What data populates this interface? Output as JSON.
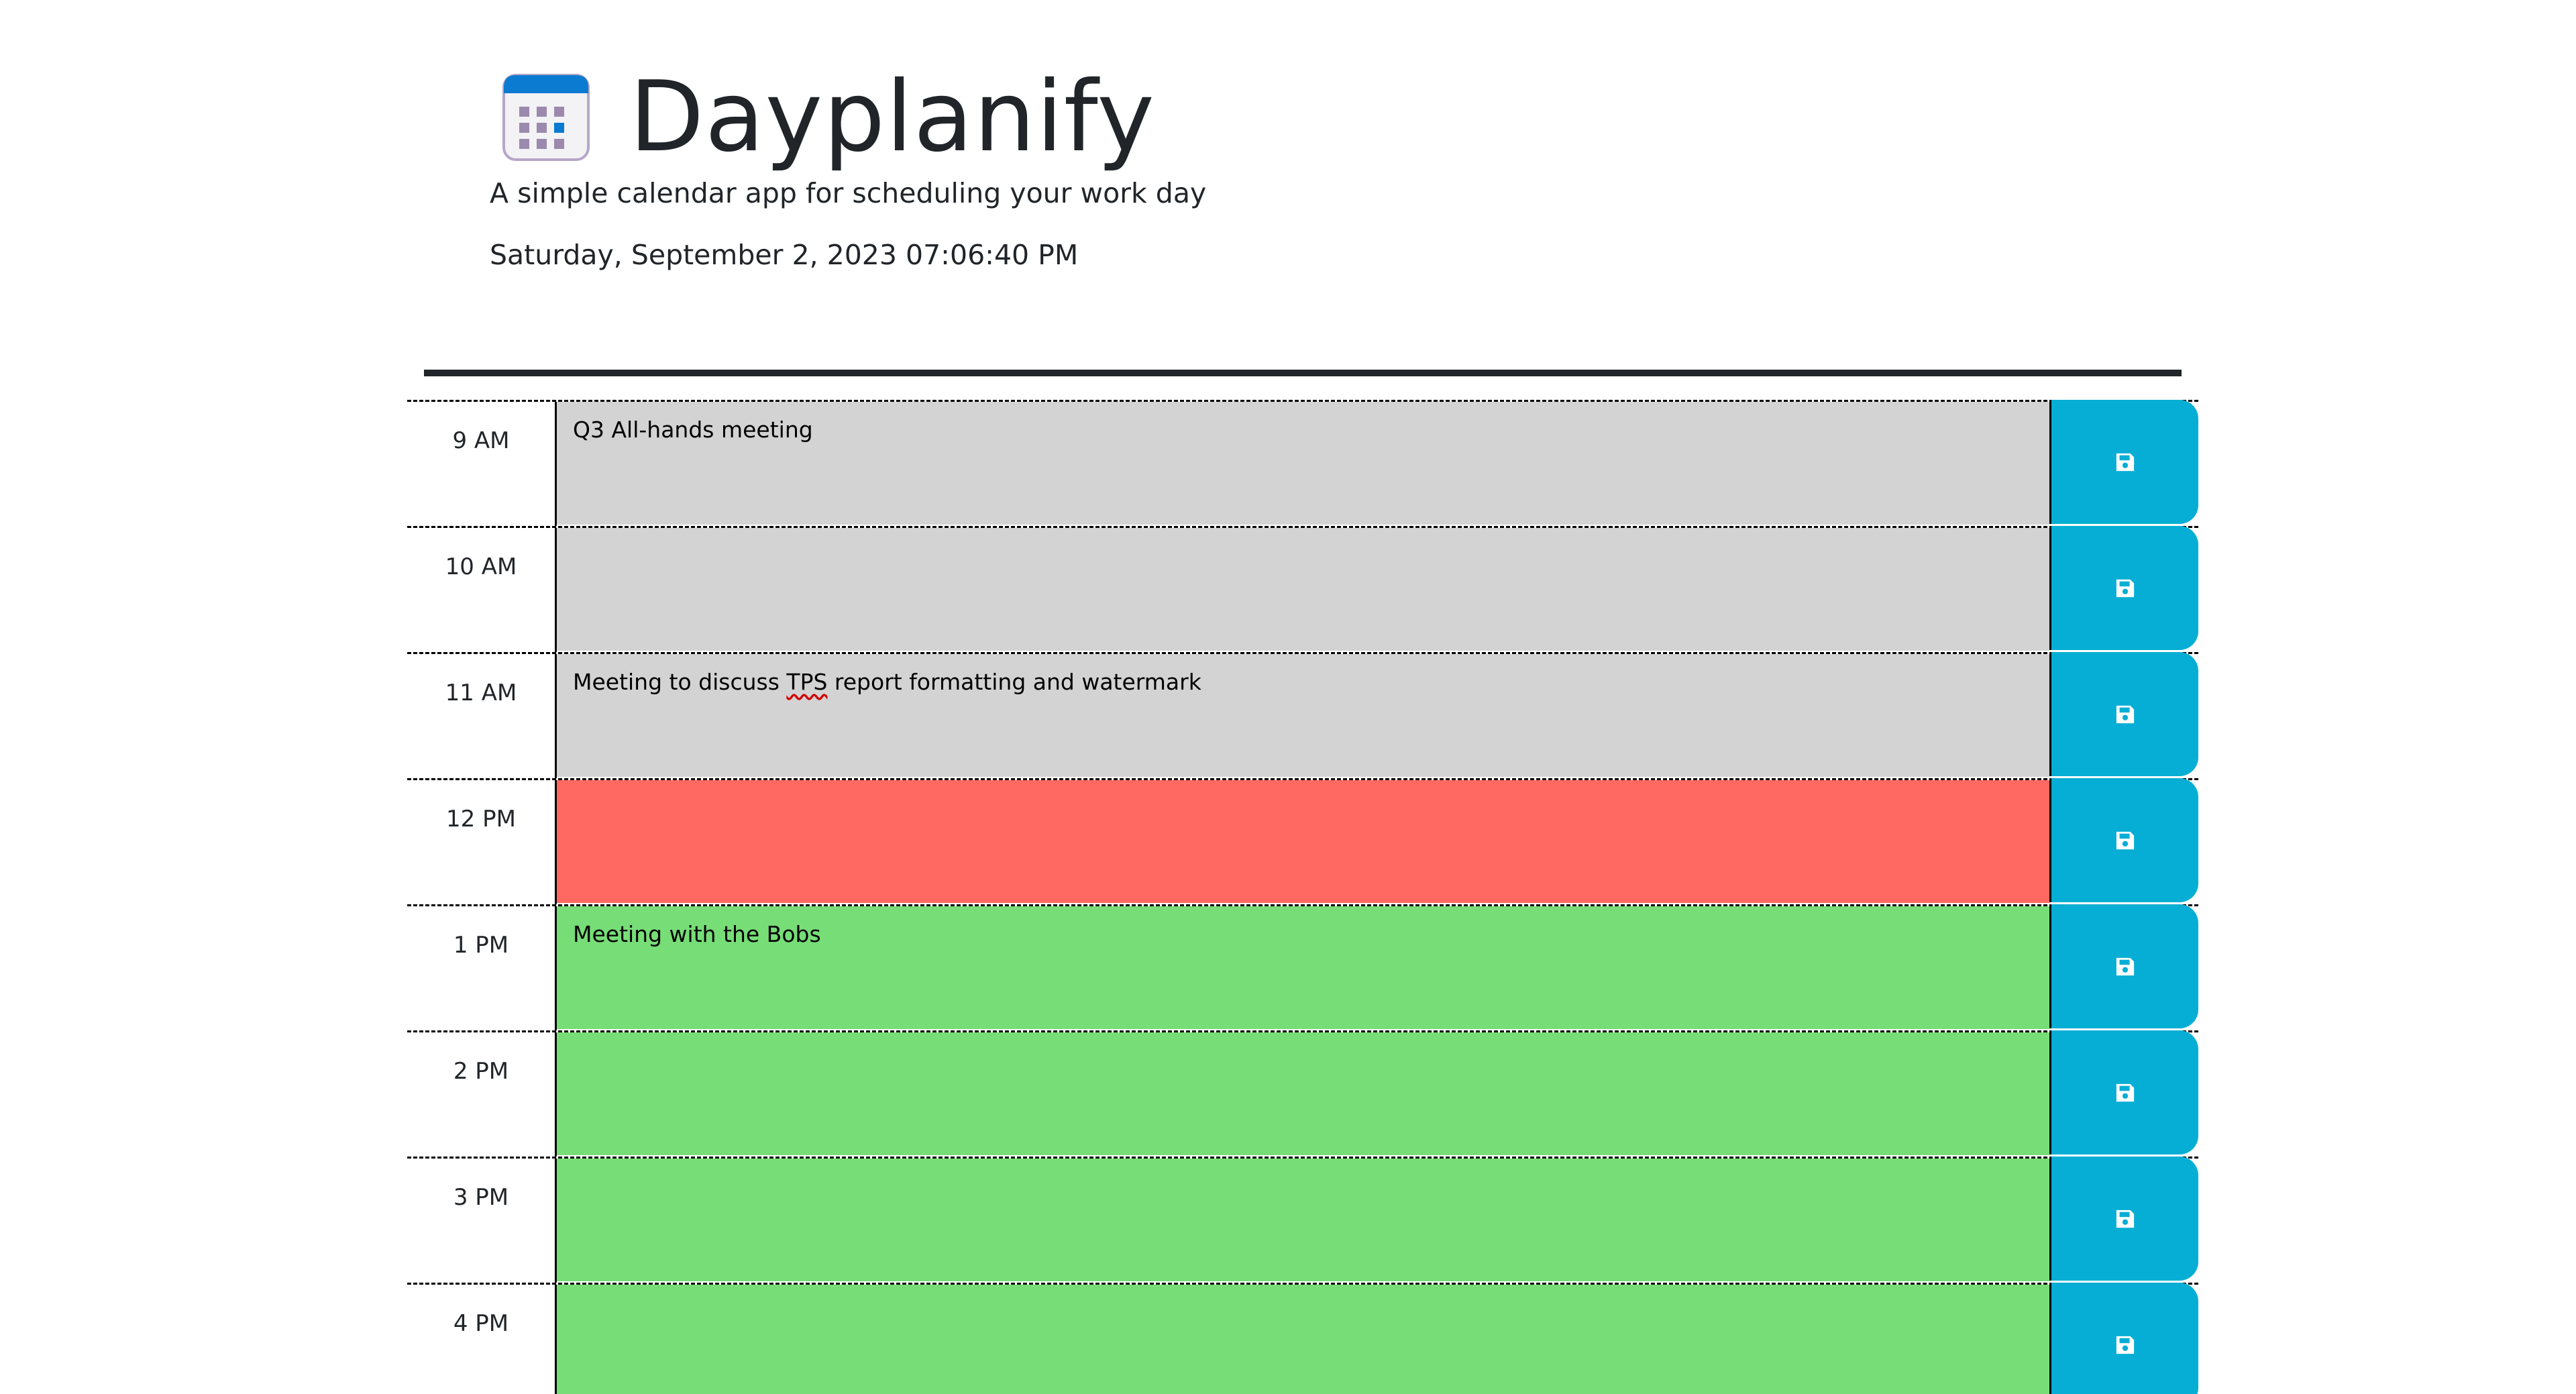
{
  "header": {
    "title": "Dayplanify",
    "subtitle": "A simple calendar app for scheduling your work day",
    "current_day": "Saturday, September 2, 2023 07:06:40 PM",
    "icon": "calendar-icon"
  },
  "colors": {
    "past": "#d3d3d3",
    "present": "#ff6961",
    "future": "#77dd77",
    "save_button": "#06aed5",
    "text": "#212529"
  },
  "schedule": {
    "save_icon": "floppy-disk-icon",
    "blocks": [
      {
        "hour": "9 AM",
        "text": "Q3 All-hands meeting",
        "status": "past"
      },
      {
        "hour": "10 AM",
        "text": "",
        "status": "past"
      },
      {
        "hour": "11 AM",
        "text_before": "Meeting to discuss ",
        "text_marked": "TPS",
        "text_after": " report formatting and watermark",
        "status": "past"
      },
      {
        "hour": "12 PM",
        "text": "",
        "status": "present"
      },
      {
        "hour": "1 PM",
        "text": "Meeting with the Bobs",
        "status": "future"
      },
      {
        "hour": "2 PM",
        "text": "",
        "status": "future"
      },
      {
        "hour": "3 PM",
        "text": "",
        "status": "future"
      },
      {
        "hour": "4 PM",
        "text": "",
        "status": "future"
      }
    ]
  }
}
